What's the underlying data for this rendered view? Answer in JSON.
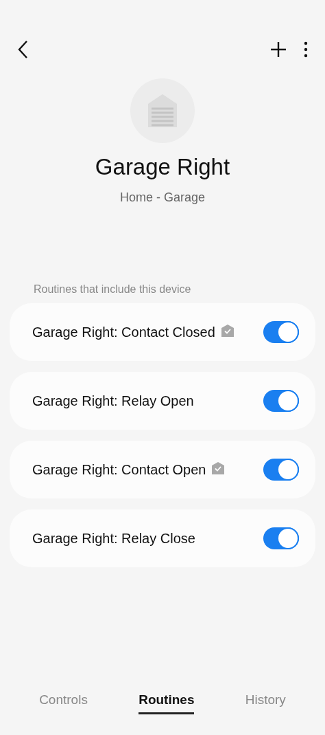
{
  "header": {
    "title": "Garage Right",
    "subtitle": "Home - Garage"
  },
  "section_label": "Routines that include this device",
  "routines": [
    {
      "name": "Garage Right: Contact Closed",
      "badge": true,
      "on": true
    },
    {
      "name": "Garage Right: Relay Open",
      "badge": false,
      "on": true
    },
    {
      "name": "Garage Right: Contact Open",
      "badge": true,
      "on": true
    },
    {
      "name": "Garage Right: Relay Close",
      "badge": false,
      "on": true
    }
  ],
  "tabs": [
    {
      "label": "Controls",
      "selected": false
    },
    {
      "label": "Routines",
      "selected": true
    },
    {
      "label": "History",
      "selected": false
    }
  ]
}
